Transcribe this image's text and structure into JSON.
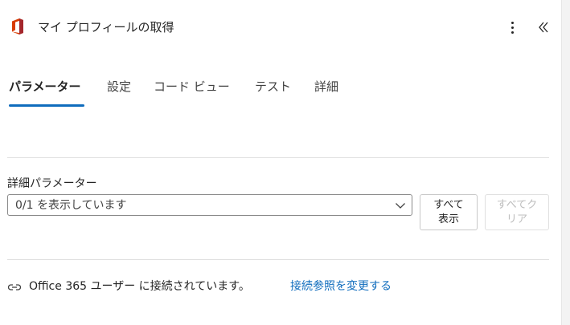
{
  "header": {
    "app_icon": "office-logo-icon",
    "title": "マイ プロフィールの取得",
    "more_icon": "more-vertical-icon",
    "collapse_icon": "chevron-double-left-icon"
  },
  "tabs": [
    {
      "label": "パラメーター",
      "active": true
    },
    {
      "label": "設定",
      "active": false
    },
    {
      "label": "コード ビュー",
      "active": false
    },
    {
      "label": "テスト",
      "active": false
    },
    {
      "label": "詳細",
      "active": false
    }
  ],
  "advanced_params": {
    "label": "詳細パラメーター",
    "dropdown_value": "0/1 を表示しています",
    "show_all_button": "すべて表示",
    "clear_all_button": "すべてクリア"
  },
  "connection": {
    "icon": "link-icon",
    "text": "Office 365 ユーザー に接続されています。",
    "change_link": "接続参照を変更する"
  },
  "colors": {
    "accent": "#0f6cbd",
    "office_red": "#d83b01",
    "disabled_text": "#bdbdbd"
  }
}
